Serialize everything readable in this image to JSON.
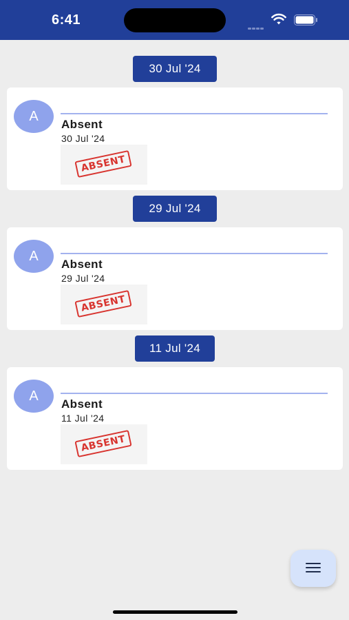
{
  "status_bar": {
    "time": "6:41",
    "signal_icon": "cellular-signal-icon",
    "wifi_icon": "wifi-icon",
    "battery_icon": "battery-icon"
  },
  "feed": {
    "groups": [
      {
        "date_header": "30 Jul '24",
        "card": {
          "avatar_initial": "A",
          "title": "Absent",
          "date": "30 Jul '24",
          "stamp_text": "ABSENT"
        }
      },
      {
        "date_header": "29 Jul '24",
        "card": {
          "avatar_initial": "A",
          "title": "Absent",
          "date": "29 Jul '24",
          "stamp_text": "ABSENT"
        }
      },
      {
        "date_header": "11 Jul '24",
        "card": {
          "avatar_initial": "A",
          "title": "Absent",
          "date": "11 Jul '24",
          "stamp_text": "ABSENT"
        }
      }
    ]
  },
  "fab": {
    "icon": "menu-icon"
  },
  "colors": {
    "primary": "#213f99",
    "avatar": "#8fa3ec",
    "stamp": "#d8342f",
    "fab": "#d6e3fb"
  }
}
